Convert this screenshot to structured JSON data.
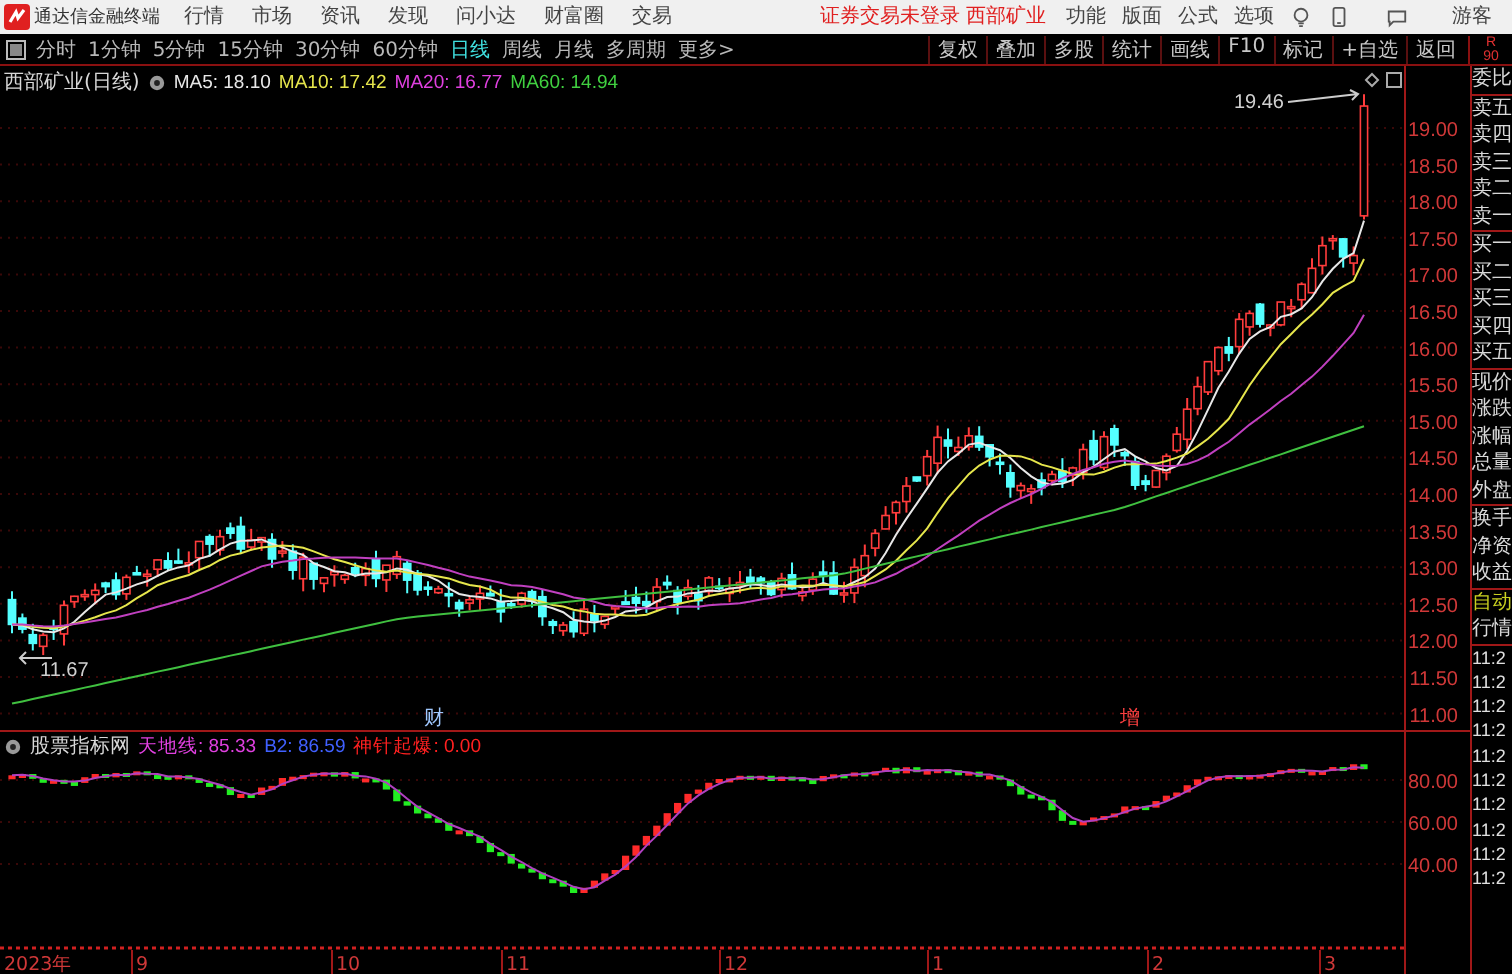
{
  "app": {
    "title": "通达信金融终端",
    "menu": [
      "行情",
      "市场",
      "资讯",
      "发现",
      "问小达",
      "财富圈",
      "交易"
    ],
    "login_status": "证券交易未登录 西部矿业",
    "tools": [
      "功能",
      "版面",
      "公式",
      "选项"
    ],
    "user": "游客"
  },
  "toolbar": {
    "periods": [
      {
        "label": "分时",
        "selected": false
      },
      {
        "label": "1分钟",
        "selected": false
      },
      {
        "label": "5分钟",
        "selected": false
      },
      {
        "label": "15分钟",
        "selected": false
      },
      {
        "label": "30分钟",
        "selected": false
      },
      {
        "label": "60分钟",
        "selected": false
      },
      {
        "label": "日线",
        "selected": true
      },
      {
        "label": "周线",
        "selected": false
      },
      {
        "label": "月线",
        "selected": false
      },
      {
        "label": "多周期",
        "selected": false
      },
      {
        "label": "更多>",
        "selected": false
      }
    ],
    "actions": [
      "复权",
      "叠加",
      "多股",
      "统计",
      "画线",
      "F10",
      "标记",
      "+自选",
      "返回"
    ],
    "side_label": [
      "R",
      "90"
    ]
  },
  "price_chart": {
    "title": "西部矿业(日线)",
    "ma_legend": [
      {
        "label": "MA5: 18.10",
        "color": "#e8e8e8"
      },
      {
        "label": "MA10: 17.42",
        "color": "#e6e64c"
      },
      {
        "label": "MA20: 16.77",
        "color": "#e040e0"
      },
      {
        "label": "MA60: 14.94",
        "color": "#40d040"
      }
    ],
    "axis_labels": [
      "19.00",
      "18.50",
      "18.00",
      "17.50",
      "17.00",
      "16.50",
      "16.00",
      "15.50",
      "15.00",
      "14.50",
      "14.00",
      "13.50",
      "13.00",
      "12.50",
      "12.00",
      "11.50",
      "11.00"
    ],
    "high_label": "19.46",
    "low_label": "11.67",
    "event_markers": [
      {
        "label": "财",
        "color": "#a0c8ff"
      },
      {
        "label": "增",
        "color": "#ff4040"
      }
    ]
  },
  "indicator": {
    "title": "股票指标网",
    "legend": [
      {
        "label": "天地线: 85.33",
        "color": "#e040e0"
      },
      {
        "label": "B2: 86.59",
        "color": "#4060ff"
      },
      {
        "label": "神针起爆: 0.00",
        "color": "#ff2020"
      }
    ],
    "axis_labels": [
      "80.00",
      "60.00",
      "40.00"
    ]
  },
  "date_axis": [
    "2023年",
    "9",
    "10",
    "11",
    "12",
    "1",
    "2",
    "3"
  ],
  "quote_panel": {
    "groups": [
      [
        "委比"
      ],
      [
        "卖五",
        "卖四",
        "卖三",
        "卖二",
        "卖一"
      ],
      [
        "买一",
        "买二",
        "买三",
        "买四",
        "买五"
      ],
      [
        "现价",
        "涨跌",
        "涨幅",
        "总量",
        "外盘"
      ],
      [
        "换手",
        "净资",
        "收益"
      ]
    ],
    "modes": [
      {
        "label": "自动",
        "active": true
      },
      {
        "label": "行情",
        "active": false
      }
    ],
    "times": [
      "11:2",
      "11:2",
      "11:2",
      "11:2",
      "11:2",
      "11:2",
      "11:2",
      "11:2",
      "11:2",
      "11:2"
    ]
  }
}
